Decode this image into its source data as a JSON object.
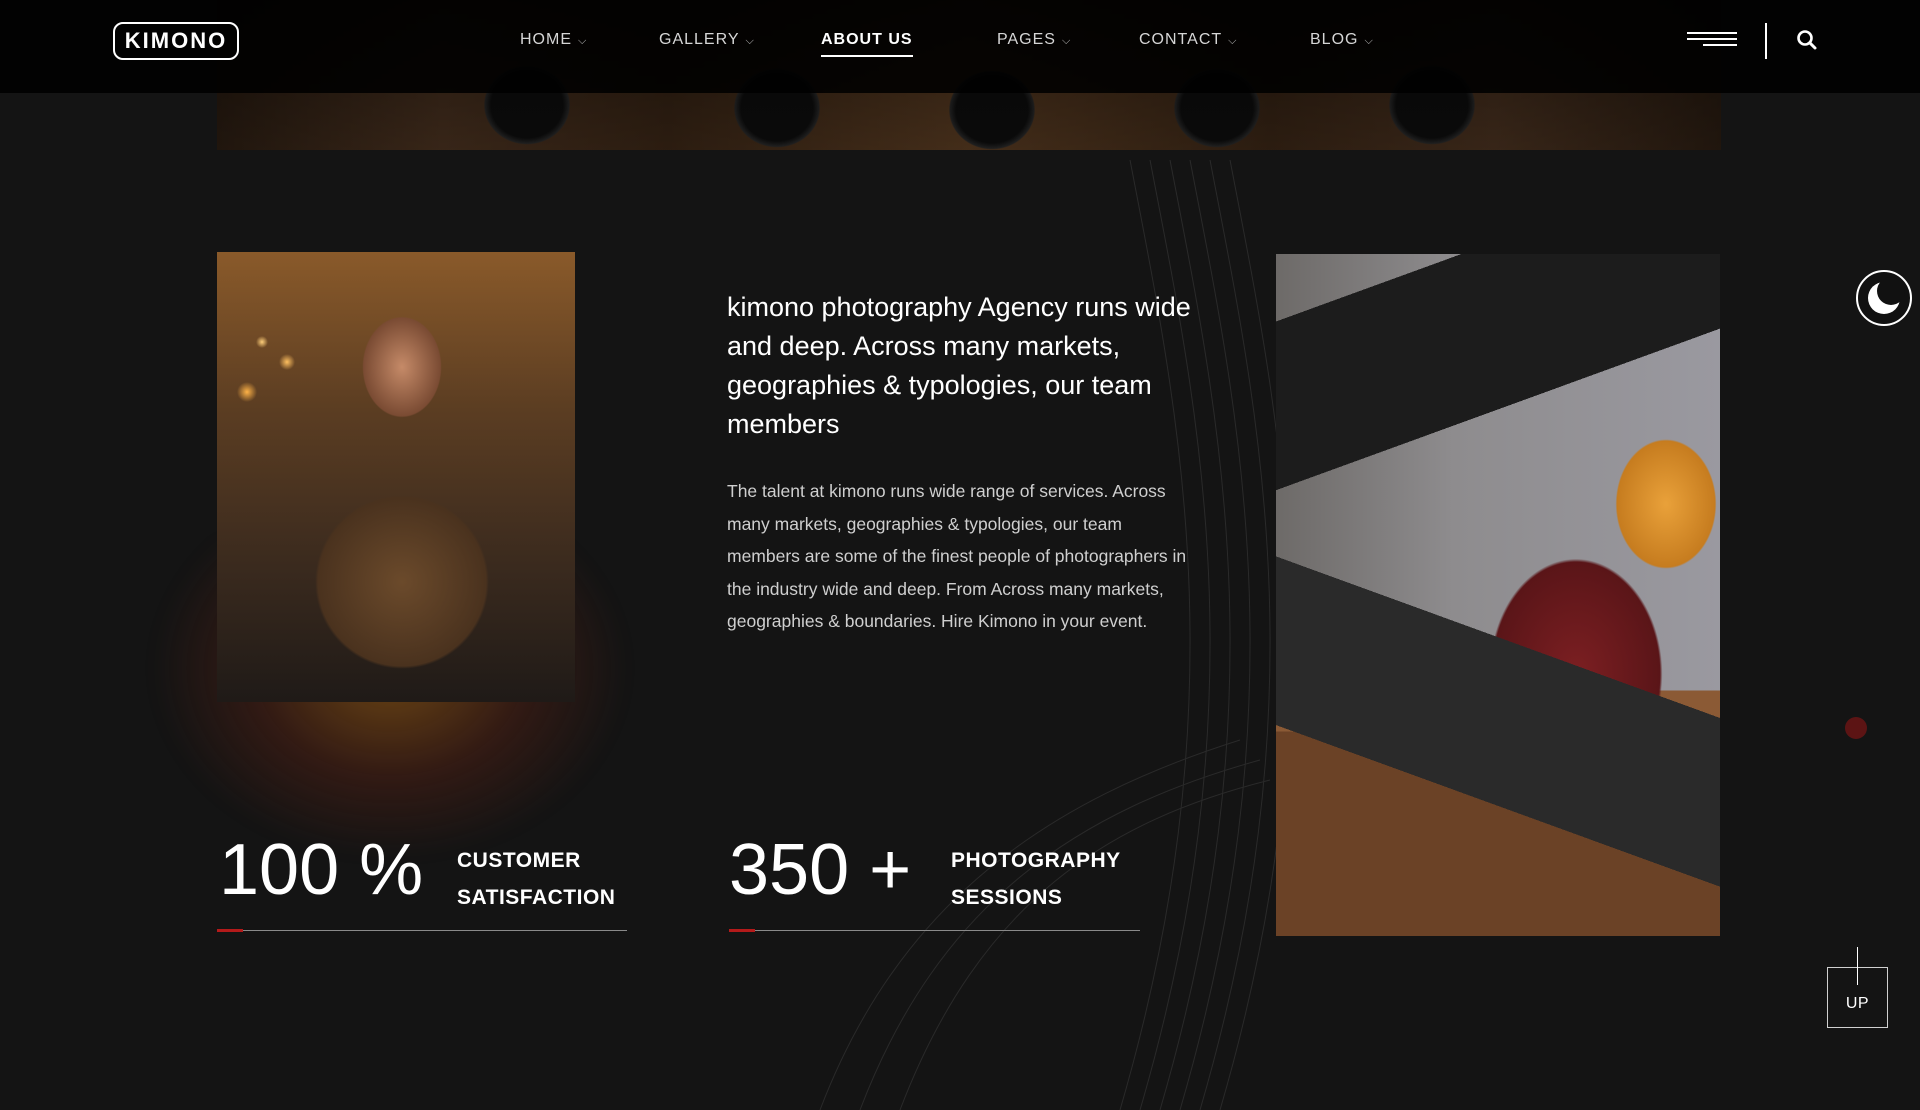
{
  "brand": {
    "logo_text": "KIMONO"
  },
  "nav": {
    "items": [
      {
        "label": "HOME",
        "has_dropdown": true
      },
      {
        "label": "GALLERY",
        "has_dropdown": true
      },
      {
        "label": "ABOUT US",
        "active": true
      },
      {
        "label": "PAGES",
        "has_dropdown": true
      },
      {
        "label": "CONTACT",
        "has_dropdown": true
      },
      {
        "label": "BLOG",
        "has_dropdown": true
      }
    ],
    "chevron": "⌵"
  },
  "header_icons": [
    "hamburger-menu-icon",
    "search-icon"
  ],
  "intro": {
    "heading": "kimono photography Agency runs wide and deep. Across many markets, geographies & typologies, our team members",
    "body": "The talent at kimono runs wide range of services. Across many markets, geographies & typologies, our team members are some of the finest people of photographers in the industry wide and deep. From Across many markets, geographies & boundaries. Hire Kimono in your event."
  },
  "stats": [
    {
      "value": "100 %",
      "label_line1": "CUSTOMER",
      "label_line2": "SATISFACTION"
    },
    {
      "value": "350 +",
      "label_line1": "PHOTOGRAPHY",
      "label_line2": "SESSIONS"
    }
  ],
  "floating": {
    "theme_icon": "moon-icon",
    "up_label": "UP"
  },
  "colors": {
    "background": "#141414",
    "accent": "#b41a1a",
    "text": "#ffffff"
  }
}
